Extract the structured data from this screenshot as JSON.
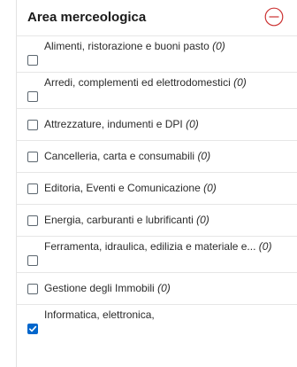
{
  "filter": {
    "title": "Area merceologica",
    "collapse_icon": "minus-circle-icon",
    "accent_color": "#cc3333",
    "check_color": "#0066cc",
    "items": [
      {
        "label": "Alimenti, ristorazione e buoni pasto",
        "count": "(0)",
        "checked": false
      },
      {
        "label": "Arredi, complementi ed elettrodomestici",
        "count": "(0)",
        "checked": false
      },
      {
        "label": "Attrezzature, indumenti e DPI",
        "count": "(0)",
        "checked": false
      },
      {
        "label": "Cancelleria, carta e consumabili",
        "count": "(0)",
        "checked": false
      },
      {
        "label": "Editoria, Eventi e Comunicazione",
        "count": "(0)",
        "checked": false
      },
      {
        "label": "Energia, carburanti e lubrificanti",
        "count": "(0)",
        "checked": false
      },
      {
        "label": "Ferramenta, idraulica, edilizia e materiale e...",
        "count": "(0)",
        "checked": false
      },
      {
        "label": "Gestione degli Immobili",
        "count": "(0)",
        "checked": false
      },
      {
        "label": "Informatica, elettronica,",
        "count": "",
        "checked": true
      }
    ]
  }
}
